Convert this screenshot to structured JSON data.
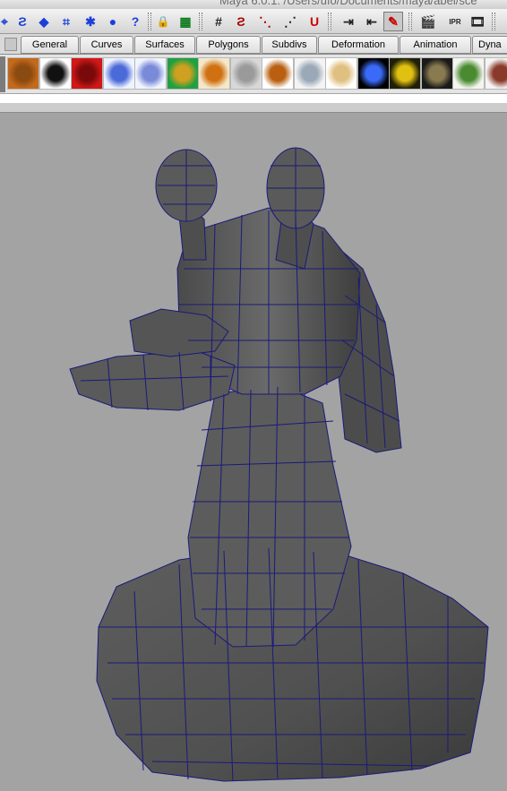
{
  "window": {
    "title": "Maya 6.0.1: /Users/ufo/Documents/maya/abel/sce"
  },
  "status_line": {
    "buttons": [
      {
        "name": "select-by-hierarchy-icon",
        "glyph": "⌖"
      },
      {
        "name": "select-curves-icon",
        "glyph": "Ƨ"
      },
      {
        "name": "select-surfaces-icon",
        "glyph": "◆"
      },
      {
        "name": "select-deformations-icon",
        "glyph": "⌗"
      },
      {
        "name": "select-dynamics-icon",
        "glyph": "✱"
      },
      {
        "name": "select-rendering-icon",
        "glyph": "●"
      },
      {
        "name": "select-misc-icon",
        "glyph": "?"
      },
      {
        "name": "lock-selection-icon",
        "glyph": "🔒"
      },
      {
        "name": "highlight-selection-icon",
        "glyph": "▦"
      },
      {
        "name": "snap-to-grid-icon",
        "glyph": "#"
      },
      {
        "name": "snap-to-curves-icon",
        "glyph": "Ƨ"
      },
      {
        "name": "snap-to-points-icon",
        "glyph": "⋱"
      },
      {
        "name": "snap-to-view-planes-icon",
        "glyph": "⋰"
      },
      {
        "name": "make-live-icon",
        "glyph": "U"
      },
      {
        "name": "input-ops-icon",
        "glyph": "⇥"
      },
      {
        "name": "output-ops-icon",
        "glyph": "⇤"
      },
      {
        "name": "construction-history-icon",
        "glyph": "✎"
      },
      {
        "name": "render-current-frame-icon",
        "glyph": "🎬"
      },
      {
        "name": "ipr-render-icon",
        "glyph": "IPR"
      },
      {
        "name": "render-globals-icon",
        "glyph": "🎞"
      }
    ]
  },
  "shelf": {
    "tabs": [
      "General",
      "Curves",
      "Surfaces",
      "Polygons",
      "Subdivs",
      "Deformation",
      "Animation",
      "Dyna"
    ],
    "brushes": [
      {
        "name": "orange-brush-icon",
        "colors": [
          "#c46a1c",
          "#8a4a10"
        ]
      },
      {
        "name": "black-splat-brush-icon",
        "colors": [
          "#ffffff",
          "#111111"
        ]
      },
      {
        "name": "red-brush-icon",
        "colors": [
          "#d01818",
          "#7a0a0a"
        ]
      },
      {
        "name": "blue-stroke-brush-icon",
        "colors": [
          "#eef3ff",
          "#4a6ad8"
        ]
      },
      {
        "name": "blue-dots-brush-icon",
        "colors": [
          "#f0f4ff",
          "#7a8ad8"
        ]
      },
      {
        "name": "rainbow-swirl-brush-icon",
        "colors": [
          "#20a040",
          "#d0a020"
        ]
      },
      {
        "name": "fire-brush-icon",
        "colors": [
          "#f4e8c8",
          "#d07010"
        ]
      },
      {
        "name": "gray-texture-brush-icon",
        "colors": [
          "#d8d8d8",
          "#9a9a9a"
        ]
      },
      {
        "name": "gold-worm-brush-icon",
        "colors": [
          "#ffffff",
          "#b86010"
        ]
      },
      {
        "name": "silver-swirl-brush-icon",
        "colors": [
          "#f4f4f4",
          "#9aa8b8"
        ]
      },
      {
        "name": "pearl-brush-icon",
        "colors": [
          "#ffffff",
          "#e0c080"
        ]
      },
      {
        "name": "neon-blue-brush-icon",
        "colors": [
          "#000000",
          "#3a6af8"
        ]
      },
      {
        "name": "yellow-spiral-brush-icon",
        "colors": [
          "#202008",
          "#e0c010"
        ]
      },
      {
        "name": "dark-hair-brush-icon",
        "colors": [
          "#1a1a1a",
          "#8a7a50"
        ]
      },
      {
        "name": "grass-brush-icon",
        "colors": [
          "#f4f4f0",
          "#4a8a30"
        ]
      },
      {
        "name": "branch-brush-icon",
        "colors": [
          "#f4f4f4",
          "#8a3a2a"
        ]
      }
    ]
  },
  "viewport": {
    "background": "#a3a3a3",
    "mesh_fill": "#5a5a5a",
    "wire_color": "#1a1a7a"
  }
}
